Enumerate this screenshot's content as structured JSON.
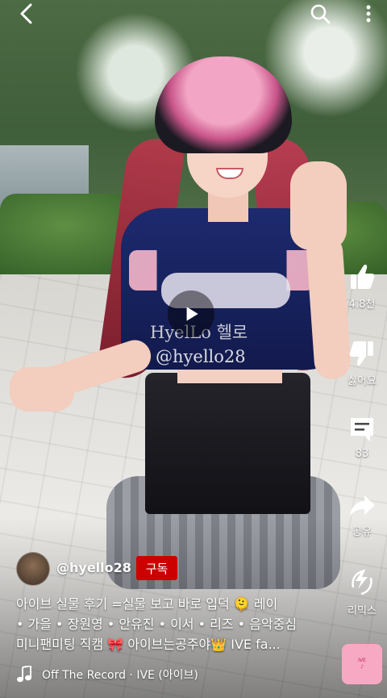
{
  "video": {
    "watermark_line1": "HyelLo 헬로",
    "watermark_line2": "@hyello28"
  },
  "actions": {
    "like_count": "4.8천",
    "dislike_label": "싫어요",
    "comment_count": "83",
    "share_label": "공유",
    "remix_label": "리믹스"
  },
  "channel": {
    "handle": "@hyello28",
    "subscribe_label": "구독"
  },
  "description": {
    "line1": "아이브 실물 후기 =실물 보고 바로 입덕 🫠 레이",
    "line2": "• 가을 • 장원영 • 안유진 • 이서 • 리즈 • 음악중심",
    "line3": "미니팬미팅 직캠 🎀 아이브는공주야👑 IVE fa..."
  },
  "music": {
    "track": "Off The Record · IVE (아이브)"
  },
  "colors": {
    "subscribe": "#cc0000",
    "text": "#ffffff"
  }
}
